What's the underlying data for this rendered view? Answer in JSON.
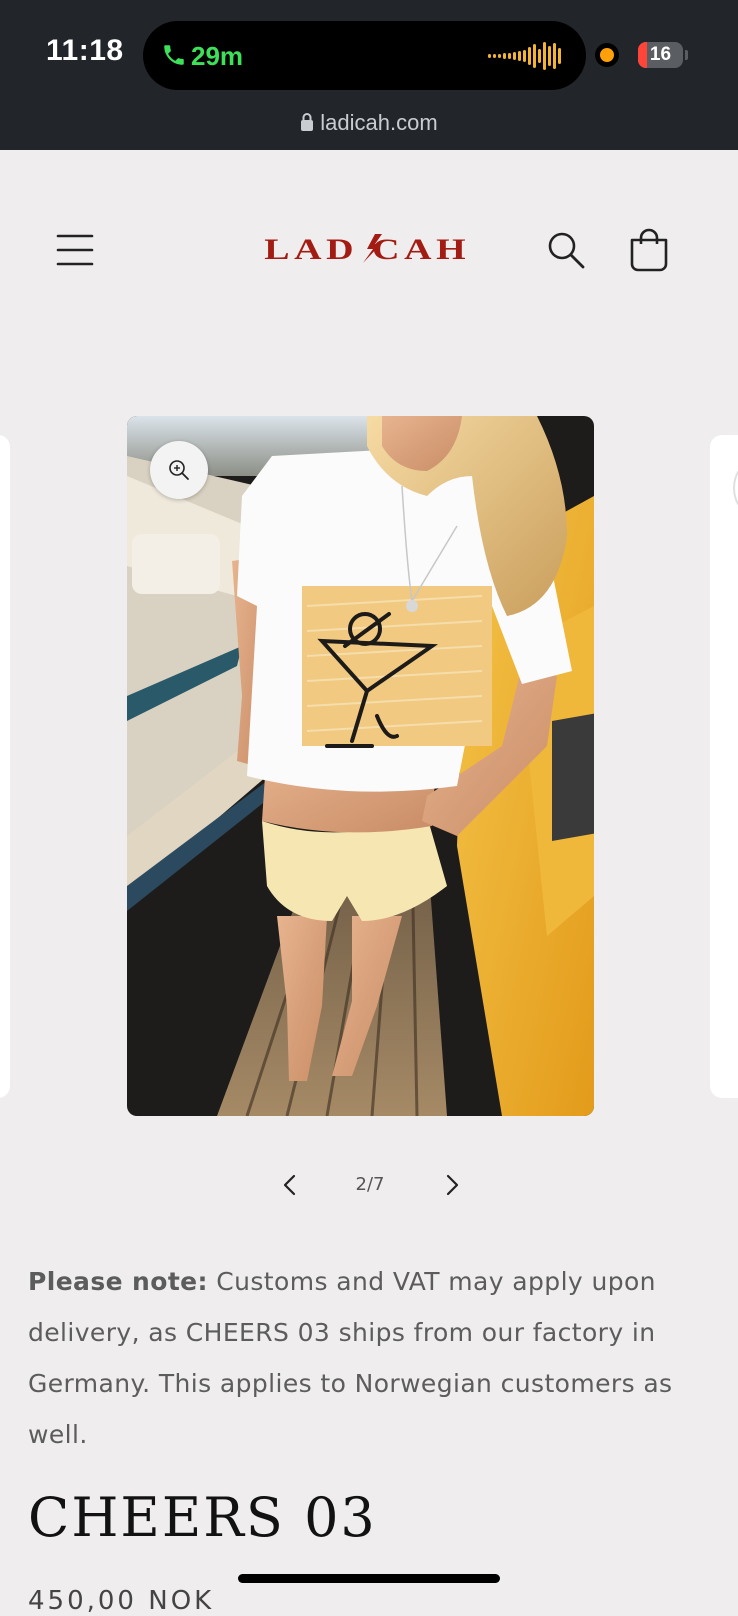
{
  "status_bar": {
    "time": "11:18",
    "call_duration": "29m",
    "battery_level": "16",
    "call_color": "#3ee05a",
    "battery_low_color": "#ff453a"
  },
  "browser": {
    "url": "ladicah.com",
    "lock_icon": "lock-icon"
  },
  "header": {
    "logo_text": "LAD/CAH",
    "logo_color": "#a31c14",
    "menu_icon": "hamburger-icon",
    "search_icon": "search-icon",
    "cart_icon": "cart-icon"
  },
  "gallery": {
    "current": 2,
    "total": 7,
    "counter_text": "2/7",
    "zoom_icon": "zoom-in-icon"
  },
  "note": {
    "label": "Please note:",
    "text": " Customs and VAT may apply upon delivery, as CHEERS 03 ships from our factory in Germany. This applies to Norwegian customers as well."
  },
  "product": {
    "title": "CHEERS 03",
    "price": "450,00 NOK"
  }
}
